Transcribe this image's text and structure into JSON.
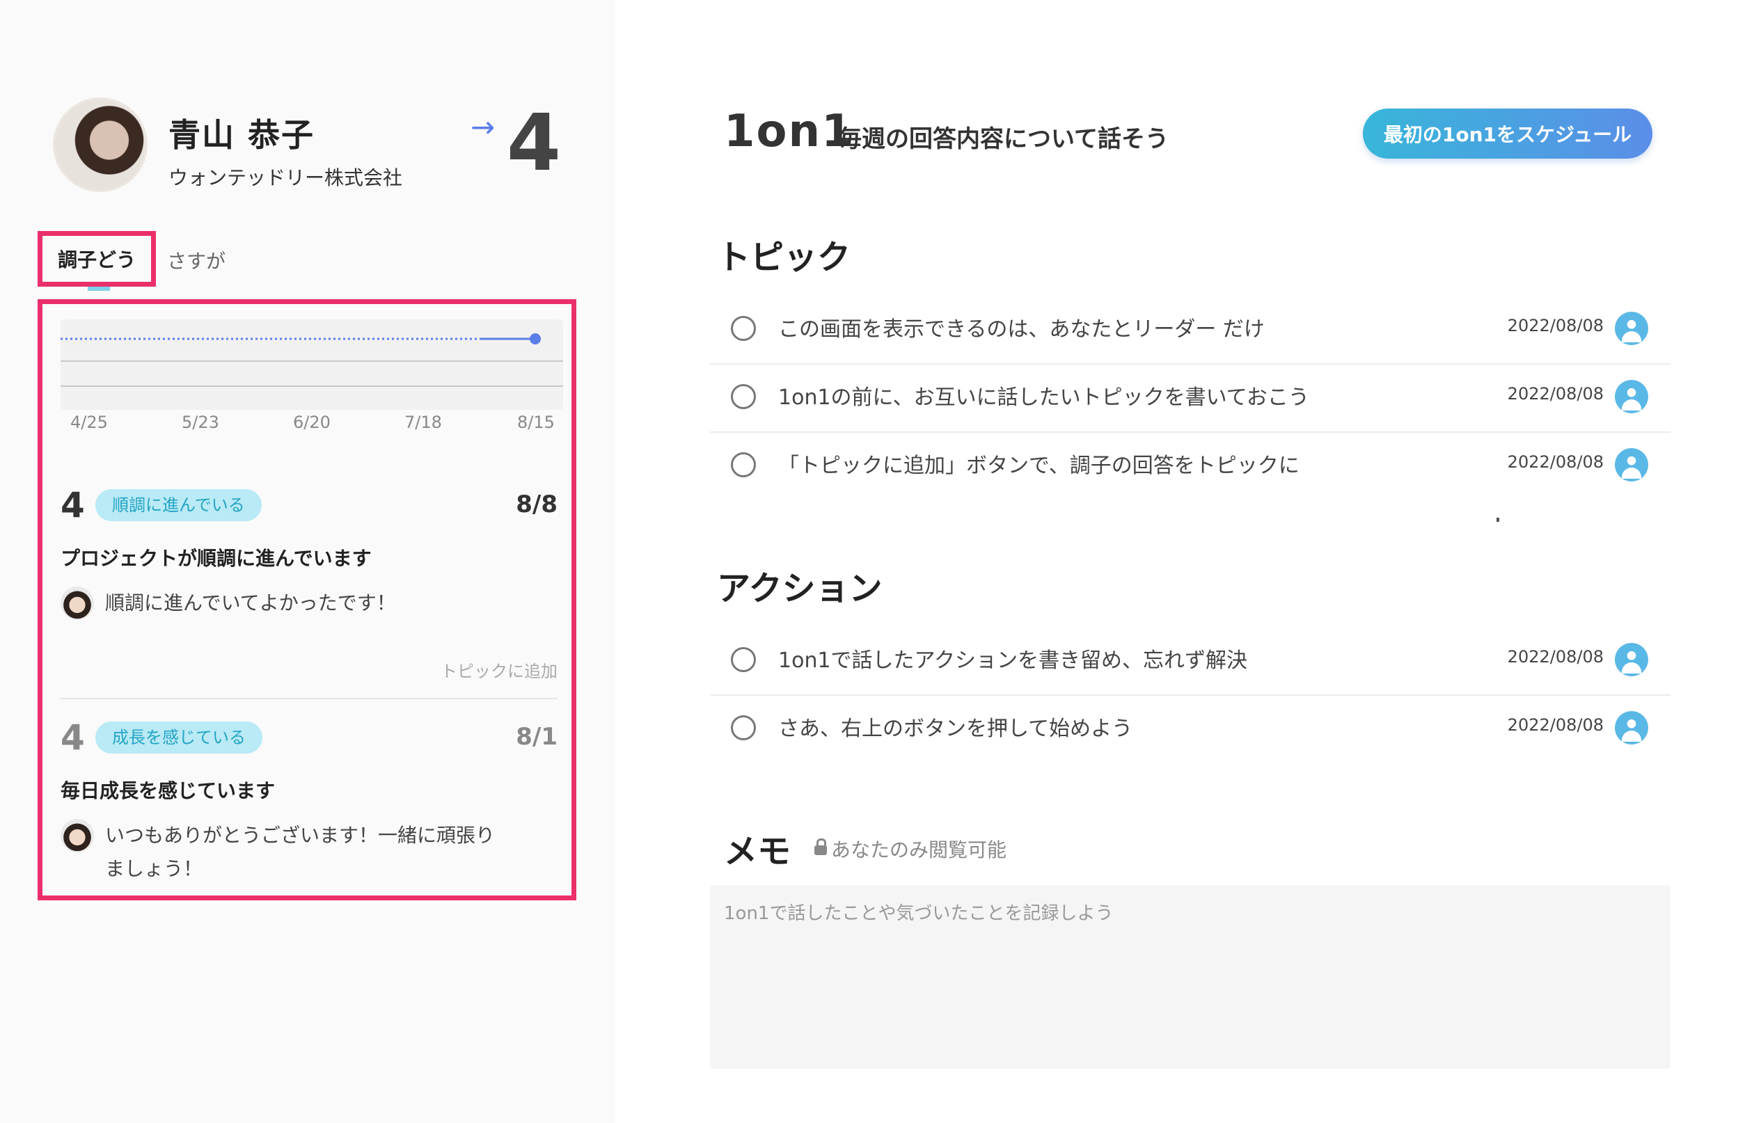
{
  "profile": {
    "name": "青山 恭子",
    "company": "ウォンテッドリー株式会社",
    "arrow": "→",
    "score": "4"
  },
  "tabs": [
    {
      "label": "調子どう",
      "active": true
    },
    {
      "label": "さすが",
      "active": false
    }
  ],
  "chart_data": {
    "type": "line",
    "x": [
      "4/25",
      "5/23",
      "6/20",
      "7/18",
      "8/15"
    ],
    "series": [
      {
        "values": [
          4,
          4,
          4,
          4,
          4
        ]
      }
    ],
    "colors": {
      "line": "#5b7de8"
    }
  },
  "entries": [
    {
      "score": "4",
      "badge": "順調に進んでいる",
      "date": "8/8",
      "title": "プロジェクトが順調に進んでいます",
      "comment": "順調に進んでいてよかったです！",
      "add_topic": "トピックに追加"
    },
    {
      "score": "4",
      "badge": "成長を感じている",
      "date": "8/1",
      "title": "毎日成長を感じています",
      "comment_line1": "いつもありがとうございます！一緒に頑張り",
      "comment_line2": "ましょう！"
    }
  ],
  "header": {
    "brand": "1on1",
    "subtitle": "毎週の回答内容について話そう",
    "schedule_button": "最初の1on1をスケジュール"
  },
  "topics": {
    "title": "トピック",
    "items": [
      {
        "text": "この画面を表示できるのは、あなたとリーダー だけ",
        "date": "2022/08/08"
      },
      {
        "text": "1on1の前に、お互いに話したいトピックを書いておこう",
        "date": "2022/08/08"
      },
      {
        "text": "「トピックに追加」ボタンで、調子の回答をトピックに",
        "date": "2022/08/08"
      }
    ]
  },
  "actions": {
    "title": "アクション",
    "items": [
      {
        "text": "1on1で話したアクションを書き留め、忘れず解決",
        "date": "2022/08/08"
      },
      {
        "text": "さあ、右上のボタンを押して始めよう",
        "date": "2022/08/08"
      }
    ]
  },
  "memo": {
    "title": "メモ",
    "visibility_note": "あなたのみ閲覧可能",
    "placeholder": "1on1で話したことや気づいたことを記録しよう"
  }
}
